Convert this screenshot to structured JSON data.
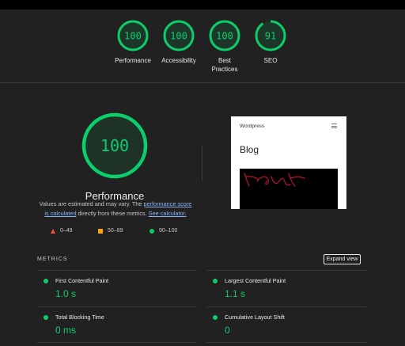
{
  "colors": {
    "pass": "#0cce6b",
    "average": "#ffa400",
    "fail": "#ff4e42",
    "background": "#212121"
  },
  "summary": [
    {
      "score": "100",
      "value": 100,
      "label": "Performance"
    },
    {
      "score": "100",
      "value": 100,
      "label": "Accessibility"
    },
    {
      "score": "100",
      "value": 100,
      "label": "Best Practices"
    },
    {
      "score": "91",
      "value": 91,
      "label": "SEO"
    }
  ],
  "performance": {
    "score": "100",
    "value": 100,
    "title": "Performance",
    "note_prefix": "Values are estimated and may vary. The ",
    "note_link1": "performance score is calculated",
    "note_mid": " directly from these metrics. ",
    "note_link2": "See calculator."
  },
  "legend": {
    "fail": "0–49",
    "average": "50–89",
    "pass": "90–100"
  },
  "screenshot": {
    "site_title": "Wordpress",
    "post_title": "Blog",
    "menu_icon": "hamburger-icon",
    "image": "handwritten-sketch"
  },
  "metrics": {
    "heading": "METRICS",
    "expand_label": "Expand view",
    "items": [
      {
        "label": "First Contentful Paint",
        "value": "1.0 s"
      },
      {
        "label": "Largest Contentful Paint",
        "value": "1.1 s"
      },
      {
        "label": "Total Blocking Time",
        "value": "0 ms"
      },
      {
        "label": "Cumulative Layout Shift",
        "value": "0"
      }
    ]
  }
}
